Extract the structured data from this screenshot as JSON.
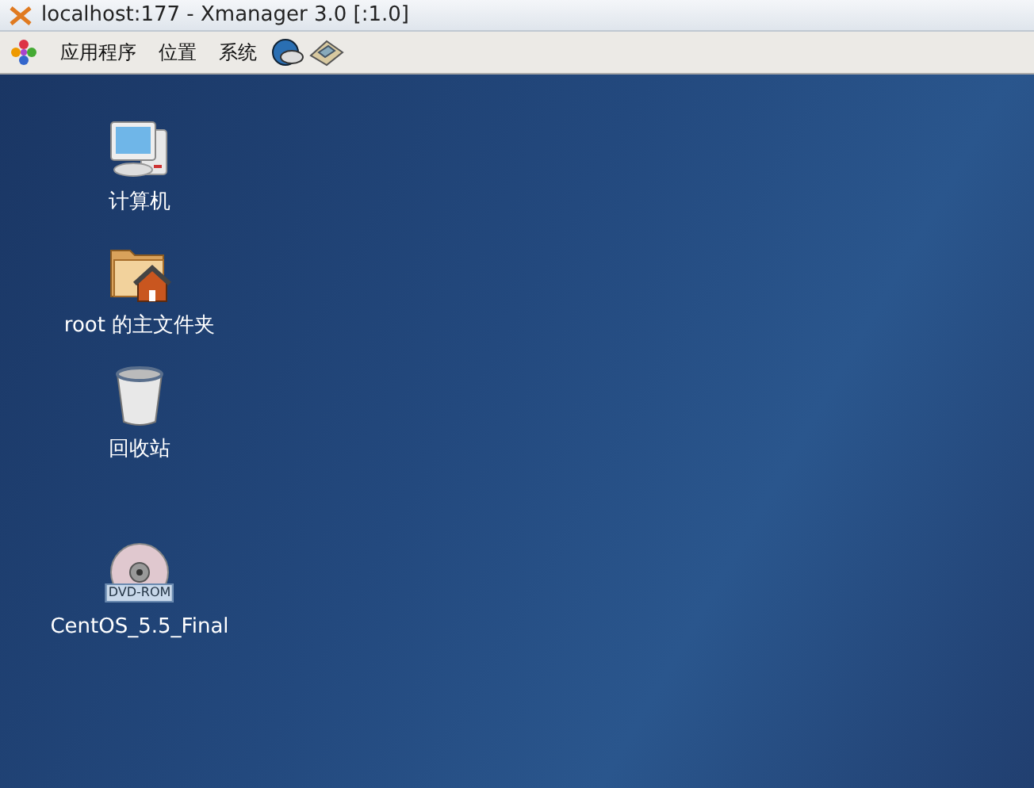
{
  "window": {
    "title": "localhost:177 - Xmanager 3.0 [:1.0]"
  },
  "menu_bar": {
    "items": [
      {
        "label": "应用程序"
      },
      {
        "label": "位置"
      },
      {
        "label": "系统"
      }
    ]
  },
  "desktop": {
    "icons": [
      {
        "kind": "computer",
        "label": "计算机"
      },
      {
        "kind": "home",
        "label": "root 的主文件夹"
      },
      {
        "kind": "trash",
        "label": "回收站"
      },
      {
        "kind": "disc",
        "label": "CentOS_5.5_Final",
        "badge": "DVD-ROM"
      }
    ]
  }
}
